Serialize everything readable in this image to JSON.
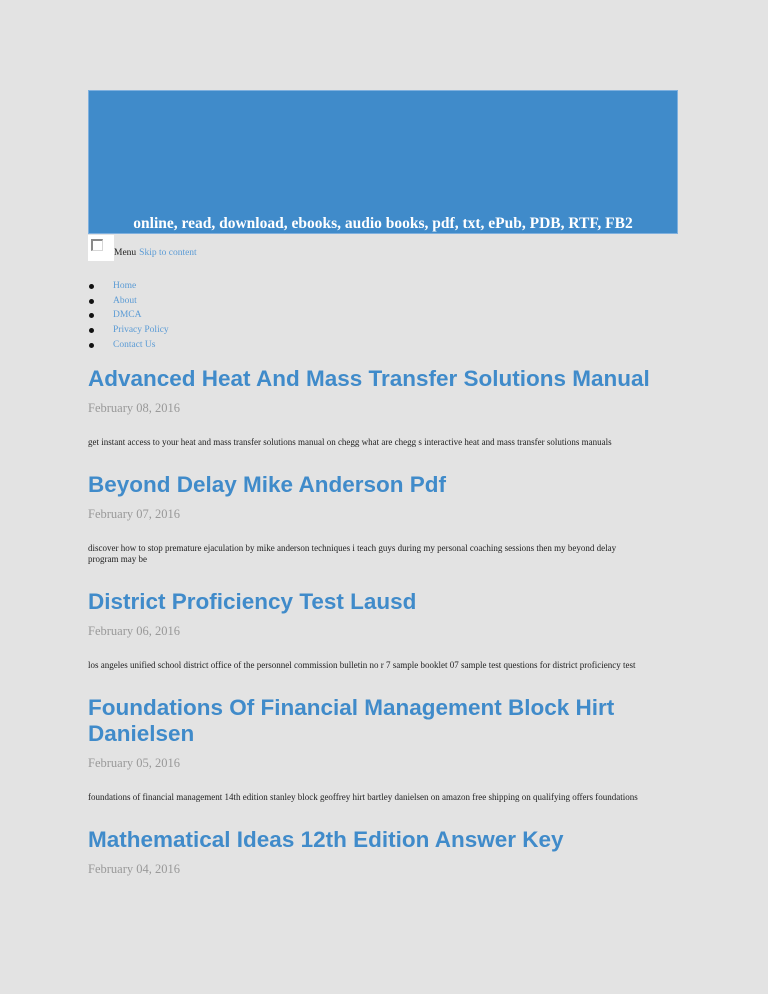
{
  "site": {
    "tagline": "online, read, download, ebooks, audio books, pdf, txt, ePub, PDB, RTF, FB2",
    "banner_color": "#408bca",
    "accent_color": "#408bca",
    "link_color": "#5b9bd5",
    "background_color": "#e3e3e3"
  },
  "menu": {
    "label": "Menu",
    "skip_link": "Skip to content",
    "checkbox_checked": false
  },
  "nav": {
    "items": [
      {
        "label": "Home"
      },
      {
        "label": "About"
      },
      {
        "label": "DMCA"
      },
      {
        "label": "Privacy Policy"
      },
      {
        "label": "Contact Us"
      }
    ]
  },
  "posts": [
    {
      "title": "Advanced Heat And Mass Transfer Solutions Manual",
      "date": "February 08, 2016",
      "excerpt": "get instant access to your heat and mass transfer solutions manual on chegg what are chegg s interactive heat and mass transfer solutions manuals"
    },
    {
      "title": "Beyond Delay Mike Anderson Pdf",
      "date": "February 07, 2016",
      "excerpt": "discover how to stop premature ejaculation by mike anderson techniques i teach guys during my personal coaching sessions then my beyond delay program may be"
    },
    {
      "title": "District Proficiency Test Lausd",
      "date": "February 06, 2016",
      "excerpt": "los angeles unified school district office of the personnel commission bulletin no r 7 sample booklet 07 sample test questions for district proficiency test"
    },
    {
      "title": "Foundations Of Financial Management Block Hirt Danielsen",
      "date": "February 05, 2016",
      "excerpt": "foundations of financial management 14th edition stanley block geoffrey hirt bartley danielsen on amazon free shipping on qualifying offers foundations"
    },
    {
      "title": "Mathematical Ideas 12th Edition Answer Key",
      "date": "February 04, 2016",
      "excerpt": null
    }
  ]
}
